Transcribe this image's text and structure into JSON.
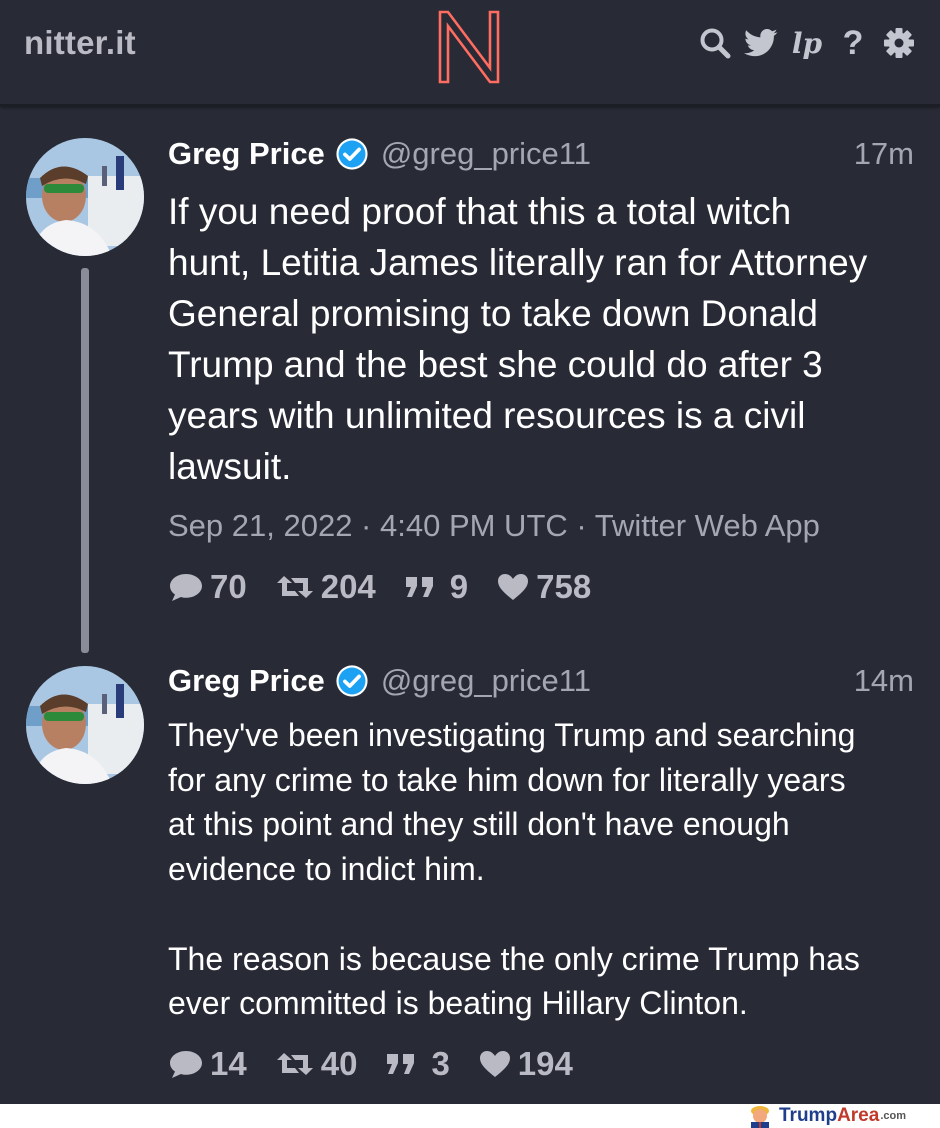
{
  "navbar": {
    "brand": "nitter.it",
    "logo_letter": "N",
    "icons": [
      "search-icon",
      "twitter-bird-icon",
      "liberapay-icon",
      "help-icon",
      "gear-icon"
    ],
    "liberapay_label": "lp",
    "help_label": "?"
  },
  "colors": {
    "background": "#282a36",
    "text": "#ffffff",
    "muted": "#a4a6b2",
    "accent": "#ff6c60",
    "verified": "#1da1f2"
  },
  "tweets": [
    {
      "fullname": "Greg Price",
      "username": "@greg_price11",
      "date": "17m",
      "text": "If you need proof that this a total witch\nhunt, Letitia James literally ran for Attorney\nGeneral promising to take down Donald\nTrump and the best she could do after 3\nyears with unlimited resources is a civil\nlawsuit.",
      "published": "Sep 21, 2022 · 4:40 PM UTC · Twitter Web App",
      "stats": {
        "replies": "70",
        "retweets": "204",
        "quotes": "9",
        "likes": "758"
      }
    },
    {
      "fullname": "Greg Price",
      "username": "@greg_price11",
      "date": "14m",
      "text": "They've been investigating Trump and searching\nfor any crime to take him down for literally years\nat this point and they still don't have enough\nevidence to indict him.\n\nThe reason is because the only crime Trump has\never committed is beating Hillary Clinton.",
      "stats": {
        "replies": "14",
        "retweets": "40",
        "quotes": "3",
        "likes": "194"
      }
    }
  ],
  "watermark": {
    "name_a": "Trump",
    "name_b": "Area",
    "domain": ".com"
  }
}
